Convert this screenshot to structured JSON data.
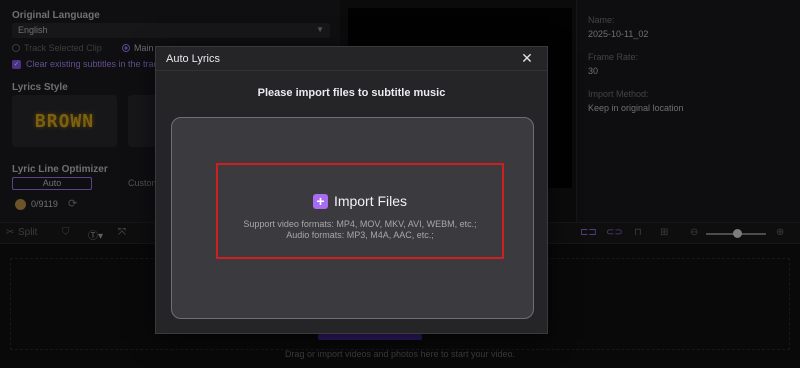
{
  "left_panel": {
    "language_label": "Original Language",
    "language_value": "English",
    "track_selected": "Track Selected Clip",
    "main_track": "Main",
    "clear_subtitles": "Clear existing subtitles in the track",
    "lyrics_style_label": "Lyrics Style",
    "style_preview_text": "BROWN",
    "optimizer_label": "Lyric Line Optimizer",
    "optimizer_auto": "Auto",
    "optimizer_custom": "Custom",
    "credits": "0/9119"
  },
  "right_panel": {
    "name_label": "Name:",
    "name_value": "2025-10-11_02",
    "frame_rate_label": "Frame Rate:",
    "frame_rate_value": "30",
    "import_method_label": "Import Method:",
    "import_method_value": "Keep in original location"
  },
  "toolbar": {
    "split": "Split"
  },
  "timeline": {
    "drop_hint": "Drag or import videos and photos here to start your video."
  },
  "modal": {
    "title": "Auto Lyrics",
    "heading": "Please import files to subtitle music",
    "import_label": "Import Files",
    "video_formats": "Support video formats: MP4, MOV, MKV, AVI, WEBM, etc.;",
    "audio_formats": "Audio formats: MP3, M4A, AAC, etc.;"
  },
  "colors": {
    "accent": "#a37bff",
    "highlight_border": "#d11e1e"
  },
  "icons": {
    "close": "close-icon",
    "plus": "plus-icon",
    "refresh": "refresh-icon"
  }
}
